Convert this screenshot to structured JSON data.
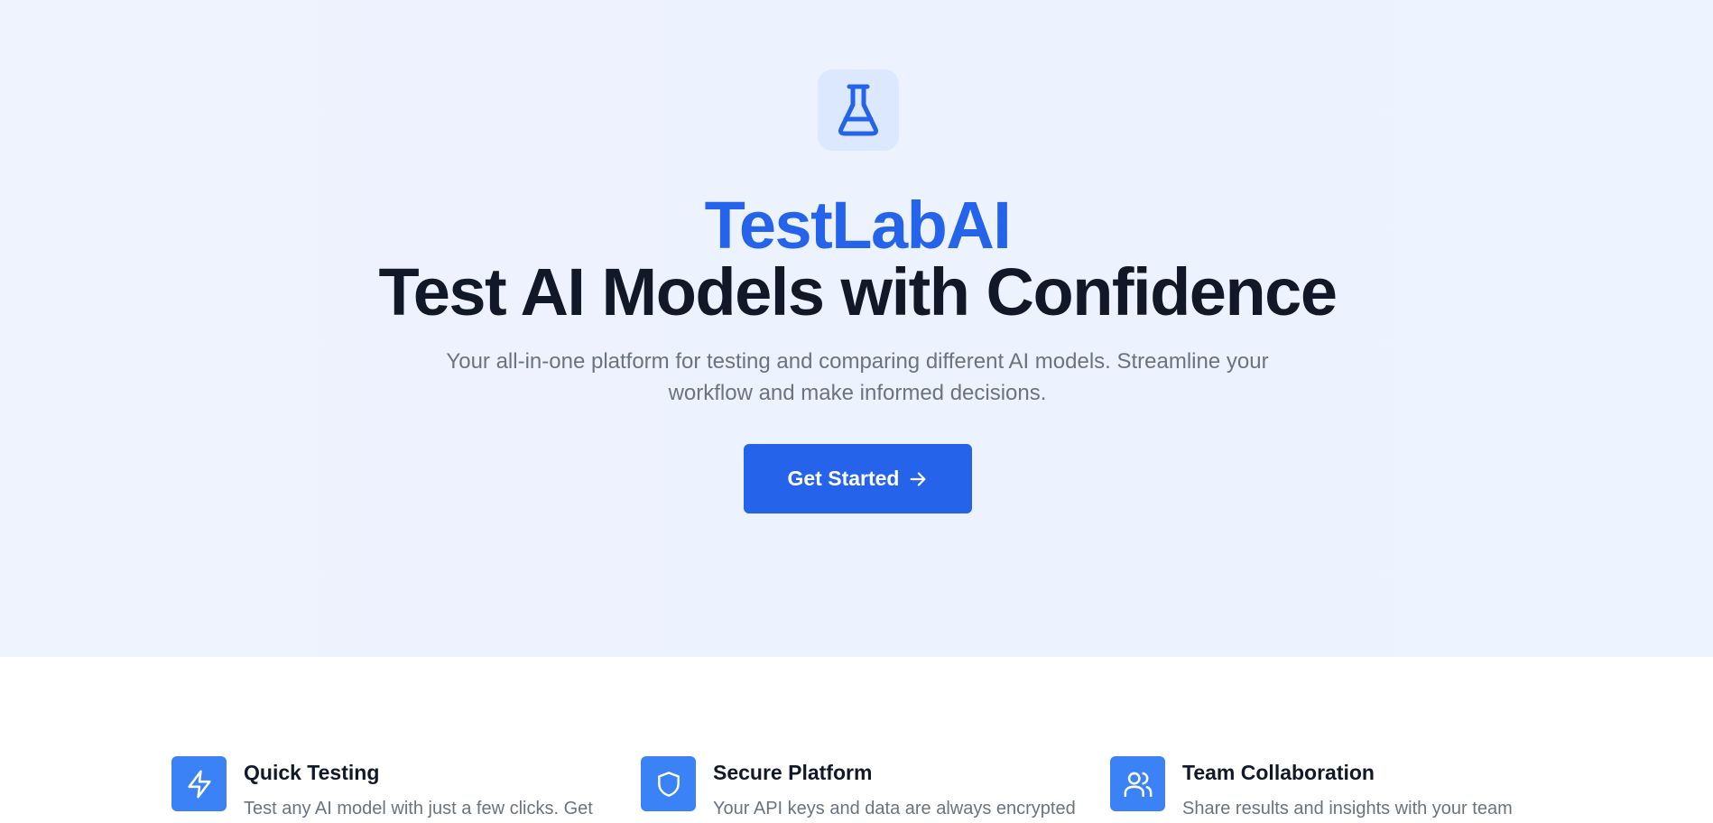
{
  "hero": {
    "logo_icon": "flask-icon",
    "brand": "TestLabAI",
    "headline": "Test AI Models with Confidence",
    "subtitle": "Your all-in-one platform for testing and comparing different AI models. Streamline your workflow and make informed decisions.",
    "cta_label": "Get Started",
    "cta_icon": "arrow-right-icon"
  },
  "features": [
    {
      "icon": "lightning-icon",
      "title": "Quick Testing",
      "description": "Test any AI model with just a few clicks. Get"
    },
    {
      "icon": "shield-icon",
      "title": "Secure Platform",
      "description": "Your API keys and data are always encrypted"
    },
    {
      "icon": "users-icon",
      "title": "Team Collaboration",
      "description": "Share results and insights with your team"
    }
  ],
  "colors": {
    "brand_blue": "#2563eb",
    "icon_tile": "#3b82f6",
    "logo_tile": "#dbe8fe",
    "heading": "#111827",
    "muted_text": "#6b7280"
  }
}
